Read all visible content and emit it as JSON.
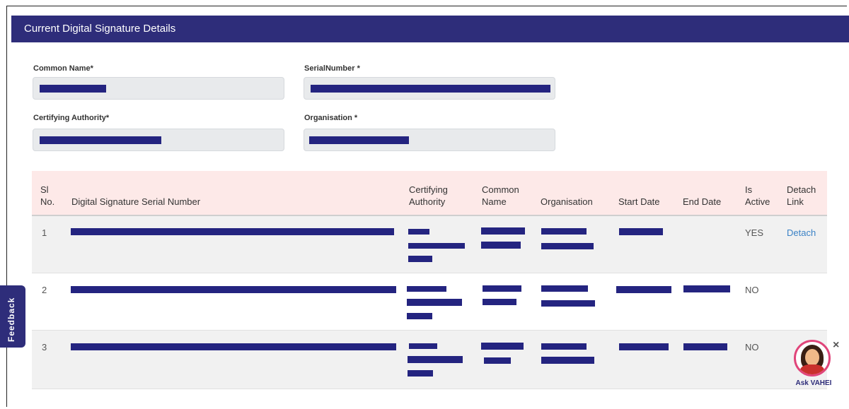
{
  "section": {
    "title": "Current Digital Signature Details"
  },
  "form": {
    "common_name_label": "Common Name*",
    "serial_number_label": "SerialNumber *",
    "certifying_authority_label": "Certifying Authority*",
    "organisation_label": "Organisation *"
  },
  "table": {
    "headers": {
      "sl_no": [
        "Sl",
        "No."
      ],
      "serial": "Digital Signature Serial Number",
      "ca": [
        "Certifying",
        "Authority"
      ],
      "common_name": [
        "Common",
        "Name"
      ],
      "organisation": "Organisation",
      "start_date": "Start Date",
      "end_date": "End Date",
      "is_active": [
        "Is",
        "Active"
      ],
      "detach": [
        "Detach",
        "Link"
      ]
    },
    "rows": [
      {
        "sl": "1",
        "is_active": "YES",
        "detach": "Detach"
      },
      {
        "sl": "2",
        "is_active": "NO",
        "detach": ""
      },
      {
        "sl": "3",
        "is_active": "NO",
        "detach": ""
      }
    ]
  },
  "feedback": {
    "label": "Feedback"
  },
  "assistant": {
    "label": "Ask VAHEI",
    "close": "×"
  },
  "colors": {
    "header_bg": "#2e2d7a",
    "table_head_bg": "#fde9e8",
    "redaction": "#242480",
    "link": "#3b82c6"
  }
}
